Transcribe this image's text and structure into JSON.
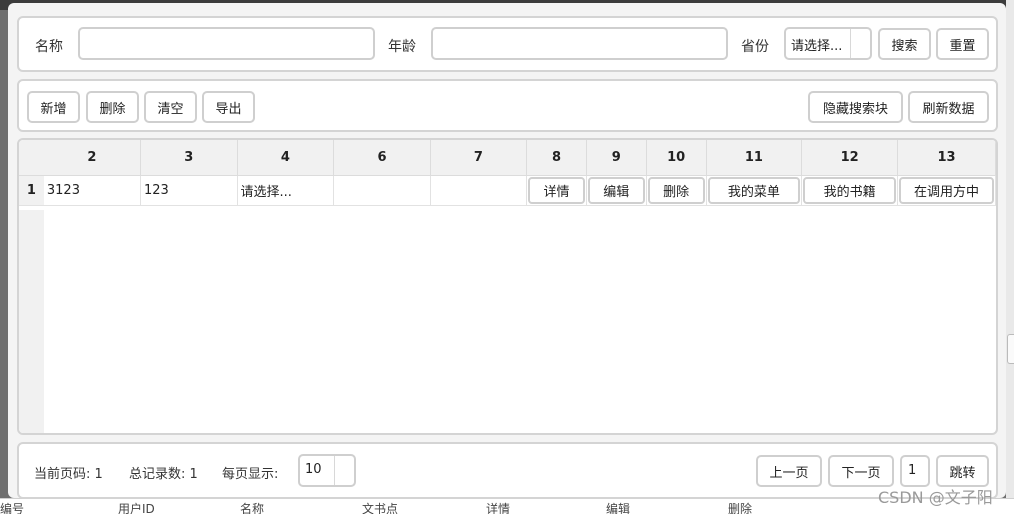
{
  "search": {
    "name_label": "名称",
    "name_value": "",
    "age_label": "年龄",
    "age_value": "",
    "province_label": "省份",
    "province_selected": "请选择...",
    "search_button": "搜索",
    "reset_button": "重置"
  },
  "toolbar": {
    "add": "新增",
    "delete": "删除",
    "clear": "清空",
    "export": "导出",
    "hide_search": "隐藏搜索块",
    "refresh": "刷新数据"
  },
  "grid": {
    "columns": [
      "2",
      "3",
      "4",
      "6",
      "7",
      "8",
      "9",
      "10",
      "11",
      "12",
      "13"
    ],
    "rows": [
      {
        "num": "1",
        "c2": "3123",
        "c3": "123",
        "c4": "请选择...",
        "c6": "",
        "c7": "",
        "btn_detail": "详情",
        "btn_edit": "编辑",
        "btn_delete": "删除",
        "btn_menu": "我的菜单",
        "btn_books": "我的书籍",
        "btn_caller": "在调用方中"
      }
    ]
  },
  "footer": {
    "current_page_label": "当前页码: 1",
    "total_label": "总记录数: 1",
    "per_page_label": "每页显示:",
    "per_page_value": "10",
    "prev": "上一页",
    "next": "下一页",
    "page_input": "1",
    "jump": "跳转"
  },
  "background": {
    "col_label_1": "编号",
    "col_label_2": "用户ID",
    "col_label_3": "名称",
    "col_label_4": "文书点",
    "col_label_5": "详情",
    "col_label_6": "编辑",
    "col_label_7": "删除"
  },
  "watermark": "CSDN @文子阳"
}
